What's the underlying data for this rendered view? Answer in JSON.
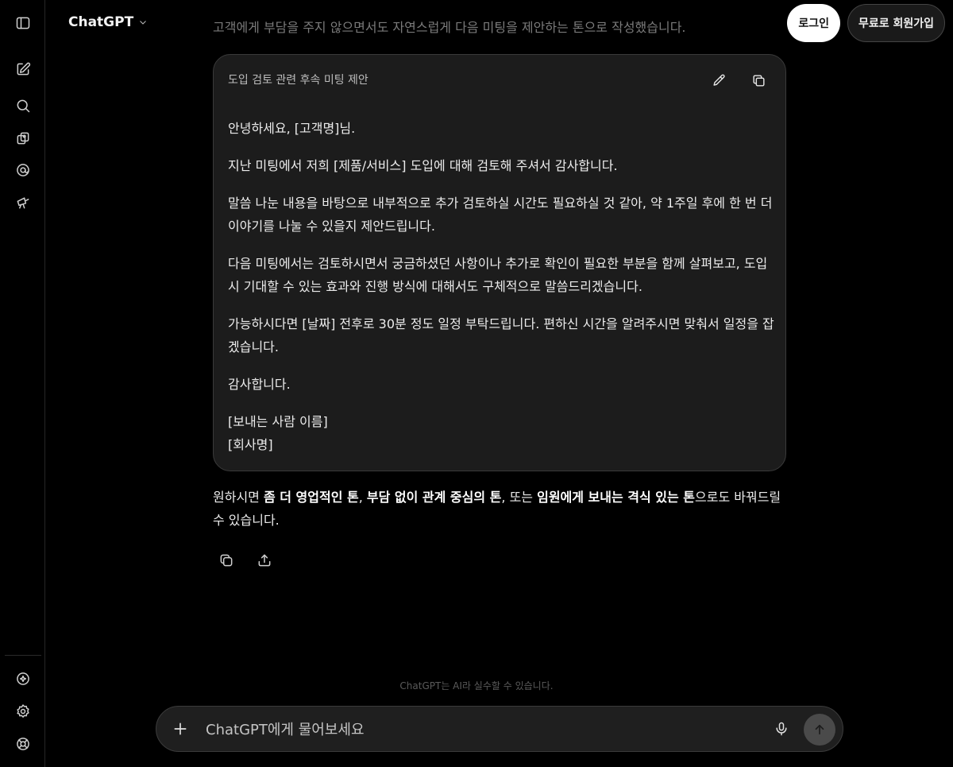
{
  "header": {
    "model_name": "ChatGPT",
    "login_label": "로그인",
    "signup_label": "무료로 회원가입"
  },
  "sidebar": {
    "top_icons": [
      "sidebar-toggle-icon",
      "new-chat-icon",
      "search-icon",
      "library-icon",
      "sora-icon",
      "explore-icon"
    ],
    "bottom_icons": [
      "upgrade-icon",
      "settings-icon",
      "help-icon"
    ]
  },
  "conversation": {
    "previous_line": "고객에게 부담을 주지 않으면서도 자연스럽게 다음 미팅을 제안하는 톤으로 작성했습니다.",
    "card": {
      "title": "도입 검토 관련 후속 미팅 제안",
      "paragraphs": [
        "안녕하세요, [고객명]님.",
        "지난 미팅에서 저희 [제품/서비스] 도입에 대해 검토해 주셔서 감사합니다.",
        "말씀 나눈 내용을 바탕으로 내부적으로 추가 검토하실 시간도 필요하실 것 같아, 약 1주일 후에 한 번 더 이야기를 나눌 수 있을지 제안드립니다.",
        "다음 미팅에서는 검토하시면서 궁금하셨던 사항이나 추가로 확인이 필요한 부분을 함께 살펴보고, 도입 시 기대할 수 있는 효과와 진행 방식에 대해서도 구체적으로 말씀드리겠습니다.",
        "가능하시다면 [날짜] 전후로 30분 정도 일정 부탁드립니다. 편하신 시간을 알려주시면 맞춰서 일정을 잡겠습니다.",
        "감사합니다."
      ],
      "signature_name": "[보내는 사람 이름]",
      "signature_company": "[회사명]"
    },
    "followup": {
      "prefix": "원하시면 ",
      "option1": "좀 더 영업적인 톤",
      "sep1": ", ",
      "option2": "부담 없이 관계 중심의 톤",
      "sep2": ", 또는 ",
      "option3": "임원에게 보내는 격식 있는 톤",
      "suffix": "으로도 바꿔드릴 수 있습니다."
    }
  },
  "disclaimer": "ChatGPT는 AI라 실수할 수 있습니다.",
  "composer": {
    "placeholder": "ChatGPT에게 물어보세요"
  }
}
